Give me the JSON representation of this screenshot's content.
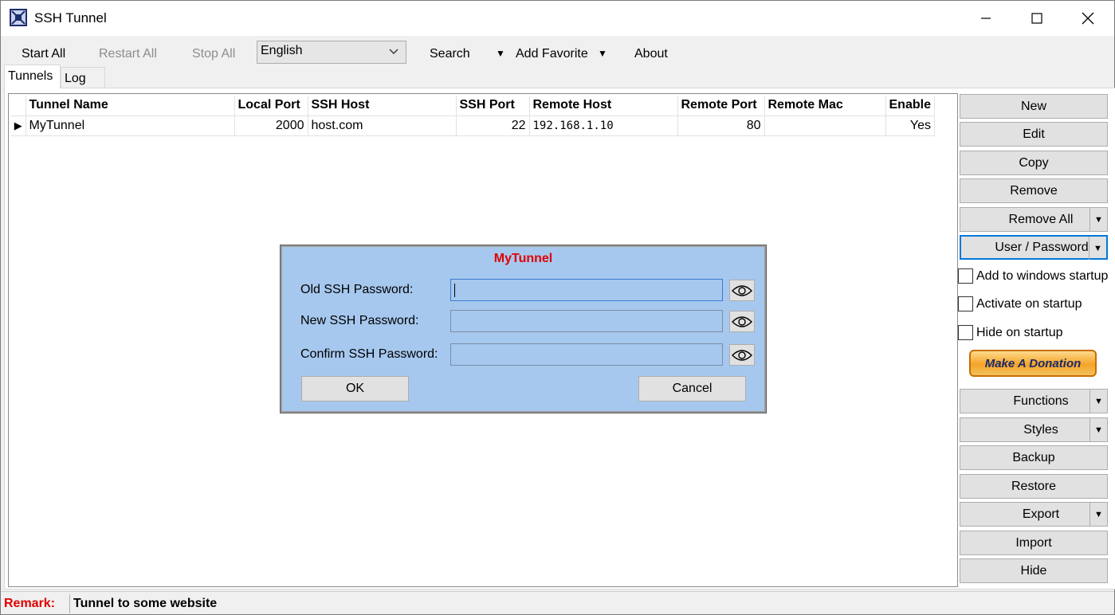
{
  "window": {
    "title": "SSH Tunnel"
  },
  "toolbar": {
    "start_all": "Start All",
    "restart_all": "Restart All",
    "stop_all": "Stop All",
    "language": "English",
    "search": "Search",
    "add_favorite": "Add Favorite",
    "about": "About"
  },
  "tabs": [
    "Tunnels",
    "Log"
  ],
  "grid": {
    "columns": [
      "Tunnel Name",
      "Local Port",
      "SSH Host",
      "SSH Port",
      "Remote Host",
      "Remote Port",
      "Remote Mac",
      "Enable"
    ],
    "rows": [
      {
        "tunnel_name": "MyTunnel",
        "local_port": "2000",
        "ssh_host": "host.com",
        "ssh_port": "22",
        "remote_host": "192.168.1.10",
        "remote_port": "80",
        "remote_mac": "",
        "enable": "Yes"
      }
    ]
  },
  "side": {
    "new": "New",
    "edit": "Edit",
    "copy": "Copy",
    "remove": "Remove",
    "remove_all": "Remove All",
    "user_password": "User / Password",
    "add_startup": "Add to windows startup",
    "activate_startup": "Activate on startup",
    "hide_startup": "Hide on startup",
    "donation": "Make A Donation",
    "functions": "Functions",
    "styles": "Styles",
    "backup": "Backup",
    "restore": "Restore",
    "export": "Export",
    "import": "Import",
    "hide": "Hide"
  },
  "dialog": {
    "title": "MyTunnel",
    "old_label": "Old SSH Password:",
    "new_label": "New SSH Password:",
    "confirm_label": "Confirm SSH Password:",
    "old_value": "",
    "new_value": "",
    "confirm_value": "",
    "ok": "OK",
    "cancel": "Cancel"
  },
  "status": {
    "remark_label": "Remark:",
    "remark_value": "Tunnel to some website"
  },
  "colors": {
    "dialog_bg": "#a6c8ee",
    "accent_red": "#e00000",
    "focus_blue": "#0078d7"
  }
}
